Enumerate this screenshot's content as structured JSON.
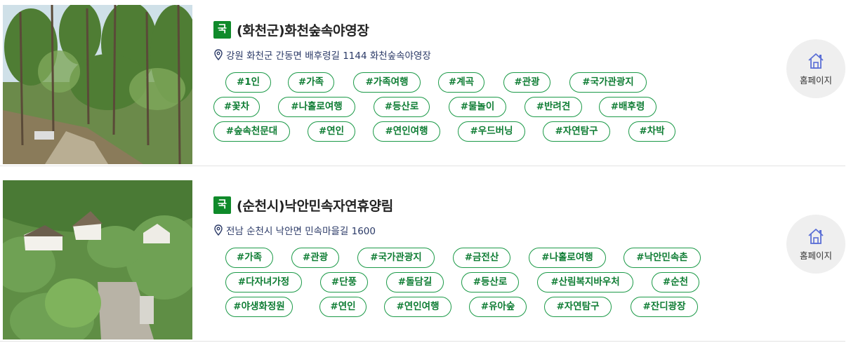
{
  "items": [
    {
      "badge": "국",
      "title": "(화천군)화천숲속야영장",
      "address": "강원 화천군 간동면 배후령길 1144 화천숲속야영장",
      "homepage_label": "홈페이지",
      "image_alt": "forest campsite",
      "tags": [
        [
          "#1인",
          "#가족",
          "#가족여행",
          "#계곡",
          "#관광",
          "#국가관광지"
        ],
        [
          "#꽃차",
          "#나홀로여행",
          "#등산로",
          "#물놀이",
          "#반려견",
          "#배후령"
        ],
        [
          "#숲속천문대",
          "#연인",
          "#연인여행",
          "#우드버닝",
          "#자연탐구",
          "#차박"
        ]
      ]
    },
    {
      "badge": "국",
      "title": "(순천시)낙안민속자연휴양림",
      "address": "전남 순천시 낙안면 민속마을길 1600",
      "homepage_label": "홈페이지",
      "image_alt": "recreation forest cabins",
      "tags": [
        [
          "#가족",
          "#관광",
          "#국가관광지",
          "#금전산",
          "#나홀로여행",
          "#낙안민속촌"
        ],
        [
          "#다자녀가정",
          "#단풍",
          "#돌담길",
          "#등산로",
          "#산림복지바우처",
          "#순천"
        ],
        [
          "#야생화정원",
          "#연인",
          "#연인여행",
          "#유아숲",
          "#자연탐구",
          "#잔디광장"
        ]
      ]
    }
  ],
  "colors": {
    "badge": "#0f8a2a",
    "tag_border": "#1c9a48",
    "tag_text": "#0f7d34",
    "address_text": "#2b3a67",
    "home_icon": "#5b6fd6"
  },
  "icons": [
    "map-pin-icon",
    "home-icon"
  ]
}
